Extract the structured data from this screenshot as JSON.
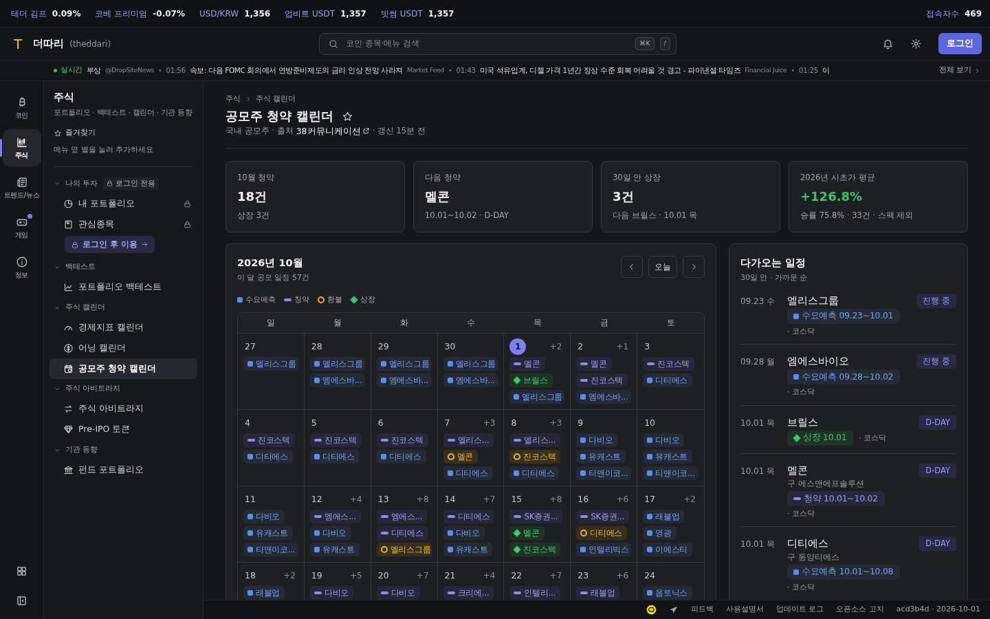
{
  "ticker_bar": {
    "items": [
      {
        "label": "테더 김프",
        "value": "0.09%"
      },
      {
        "label": "코베 프리미엄",
        "value": "-0.07%"
      },
      {
        "label": "USD/KRW",
        "value": "1,356"
      },
      {
        "label": "업비트 USDT",
        "value": "1,357"
      },
      {
        "label": "빗썸 USDT",
        "value": "1,357"
      }
    ],
    "visitors": {
      "label": "접속자수",
      "value": "469"
    }
  },
  "header": {
    "logo_mark": "T",
    "brand": "더따리",
    "brand_sub": "(theddari)",
    "search": {
      "placeholder": "코인·종목·메뉴 검색",
      "shortcuts": [
        "⌘K",
        "/"
      ]
    },
    "login_button": "로그인"
  },
  "news": {
    "live_label": "실시간",
    "see_all": "전체 보기",
    "separator": "•",
    "items": [
      {
        "title": "부상",
        "source": "@DropSiteNews"
      },
      {
        "time": "01:56",
        "title": "속보: 다음 FOMC 회의에서 연방준비제도의 금리 인상 전망 사라져",
        "source": "Market Feed"
      },
      {
        "time": "01:43",
        "title": "미국 석유업계, 디젤 가격 1년간 정상 수준 회복 어려울 것 경고 - 파이낸셜 타임즈",
        "source": "Financial Juice"
      },
      {
        "time": "01:25",
        "title": "이"
      }
    ]
  },
  "rail": {
    "items": [
      {
        "kind": "coin",
        "label": "코인",
        "selected": false,
        "notification": false
      },
      {
        "kind": "stock",
        "label": "주식",
        "selected": true,
        "notification": false
      },
      {
        "kind": "news",
        "label": "트렌드/뉴스",
        "selected": false,
        "notification": false
      },
      {
        "kind": "game",
        "label": "게임",
        "selected": false,
        "notification": true
      },
      {
        "kind": "info",
        "label": "정보",
        "selected": false,
        "notification": false
      }
    ]
  },
  "sidebar": {
    "title": "주식",
    "subtitle": "포트폴리오 · 백테스트 · 캘린더 · 기관 동향",
    "favorites": {
      "label": "즐겨찾기",
      "hint": "메뉴 옆 별을 눌러 추가하세요"
    },
    "groups": [
      {
        "label": "나의 투자",
        "expanded": true,
        "badge": "로그인 전용",
        "items": [
          {
            "kind": "portfolio",
            "label": "내 포트폴리오",
            "locked": true,
            "selected": false
          },
          {
            "kind": "watchlist",
            "label": "관심종목",
            "locked": true,
            "selected": false
          }
        ],
        "action": "로그인 후 이용"
      },
      {
        "label": "백테스트",
        "expanded": true,
        "items": [
          {
            "kind": "backtest",
            "label": "포트폴리오 백테스트",
            "locked": false,
            "selected": false
          }
        ]
      },
      {
        "label": "주식 캘린더",
        "expanded": true,
        "items": [
          {
            "kind": "economic",
            "label": "경제지표 캘린더",
            "locked": false,
            "selected": false
          },
          {
            "kind": "earnings",
            "label": "어닝 캘린더",
            "locked": false,
            "selected": false
          },
          {
            "kind": "ipo",
            "label": "공모주 청약 캘린더",
            "locked": false,
            "selected": true
          }
        ]
      },
      {
        "label": "주식 아비트라지",
        "expanded": true,
        "items": [
          {
            "kind": "arbitrage",
            "label": "주식 아비트라지",
            "locked": false,
            "selected": false
          },
          {
            "kind": "token",
            "label": "Pre-IPO 토큰",
            "locked": false,
            "selected": false
          }
        ]
      },
      {
        "label": "기관 동향",
        "expanded": true,
        "items": [
          {
            "kind": "fund",
            "label": "펀드 포트폴리오",
            "locked": false,
            "selected": false
          }
        ]
      }
    ]
  },
  "page": {
    "breadcrumb": [
      "주식",
      "주식 캘린더"
    ],
    "title": "공모주 청약 캘린더",
    "favorite": false,
    "subline": {
      "prefix": "국내 공모주 · 출처",
      "link": "38커뮤니케이션",
      "suffix": "· 갱신 15분 전"
    },
    "stats": [
      {
        "label": "10월 청약",
        "value": "18건",
        "note": "상장 3건",
        "positive": false
      },
      {
        "label": "다음 청약",
        "value": "멜콘",
        "note": "10.01~10.02 · D-DAY",
        "positive": false
      },
      {
        "label": "30일 안 상장",
        "value": "3건",
        "note": "다음 브릴스 · 10.01 목",
        "positive": false
      },
      {
        "label": "2026년 시초가 평균",
        "value": "+126.8%",
        "note": "승률 75.8% · 33건 · 스팩 제외",
        "positive": true
      }
    ]
  },
  "calendar": {
    "title": "2026년 10월",
    "subtitle": "이 달 공모 일정 57건",
    "today_button": "오늘",
    "legend": [
      {
        "kind": "demand",
        "label": "수요예측"
      },
      {
        "kind": "subscription",
        "label": "청약"
      },
      {
        "kind": "refund",
        "label": "환불"
      },
      {
        "kind": "listing",
        "label": "상장"
      }
    ],
    "weekdays": [
      "일",
      "월",
      "화",
      "수",
      "목",
      "금",
      "토"
    ],
    "weeks": [
      [
        {
          "day": "27",
          "today": false,
          "events": [
            {
              "kind": "demand",
              "label": "엘리스그룹"
            }
          ]
        },
        {
          "day": "28",
          "today": false,
          "events": [
            {
              "kind": "demand",
              "label": "엘리스그룹"
            },
            {
              "kind": "demand",
              "label": "엠에스바..."
            }
          ]
        },
        {
          "day": "29",
          "today": false,
          "events": [
            {
              "kind": "demand",
              "label": "엘리스그룹"
            },
            {
              "kind": "demand",
              "label": "엠에스바..."
            }
          ]
        },
        {
          "day": "30",
          "today": false,
          "events": [
            {
              "kind": "demand",
              "label": "엘리스그룹"
            },
            {
              "kind": "demand",
              "label": "엠에스바..."
            }
          ]
        },
        {
          "day": "1",
          "more": "+2",
          "today": true,
          "events": [
            {
              "kind": "subscription",
              "label": "멜콘"
            },
            {
              "kind": "listing",
              "label": "브릴스"
            },
            {
              "kind": "demand",
              "label": "엘리스그룹"
            }
          ]
        },
        {
          "day": "2",
          "more": "+1",
          "today": false,
          "events": [
            {
              "kind": "subscription",
              "label": "멜콘"
            },
            {
              "kind": "subscription",
              "label": "진코스텍"
            },
            {
              "kind": "demand",
              "label": "엠에스바..."
            }
          ]
        },
        {
          "day": "3",
          "today": false,
          "events": [
            {
              "kind": "subscription",
              "label": "진코스텍"
            },
            {
              "kind": "demand",
              "label": "디티에스"
            }
          ]
        }
      ],
      [
        {
          "day": "4",
          "today": false,
          "events": [
            {
              "kind": "subscription",
              "label": "진코스텍"
            },
            {
              "kind": "demand",
              "label": "디티에스"
            }
          ]
        },
        {
          "day": "5",
          "today": false,
          "events": [
            {
              "kind": "subscription",
              "label": "진코스텍"
            },
            {
              "kind": "demand",
              "label": "디티에스"
            }
          ]
        },
        {
          "day": "6",
          "today": false,
          "events": [
            {
              "kind": "subscription",
              "label": "진코스텍"
            },
            {
              "kind": "demand",
              "label": "디티에스"
            }
          ]
        },
        {
          "day": "7",
          "more": "+3",
          "today": false,
          "events": [
            {
              "kind": "subscription",
              "label": "엘리스..."
            },
            {
              "kind": "refund",
              "label": "멜콘"
            },
            {
              "kind": "demand",
              "label": "디티에스"
            }
          ]
        },
        {
          "day": "8",
          "more": "+3",
          "today": false,
          "events": [
            {
              "kind": "subscription",
              "label": "엘리스..."
            },
            {
              "kind": "refund",
              "label": "진코스텍"
            },
            {
              "kind": "demand",
              "label": "디티에스"
            }
          ]
        },
        {
          "day": "9",
          "today": false,
          "events": [
            {
              "kind": "demand",
              "label": "다비오"
            },
            {
              "kind": "demand",
              "label": "유캐스트"
            },
            {
              "kind": "demand",
              "label": "티앤이코..."
            }
          ]
        },
        {
          "day": "10",
          "today": false,
          "events": [
            {
              "kind": "demand",
              "label": "다비오"
            },
            {
              "kind": "demand",
              "label": "유캐스트"
            },
            {
              "kind": "demand",
              "label": "티앤이코..."
            }
          ]
        }
      ],
      [
        {
          "day": "11",
          "today": false,
          "events": [
            {
              "kind": "demand",
              "label": "다비오"
            },
            {
              "kind": "demand",
              "label": "유캐스트"
            },
            {
              "kind": "demand",
              "label": "티앤이코..."
            }
          ]
        },
        {
          "day": "12",
          "more": "+4",
          "today": false,
          "events": [
            {
              "kind": "subscription",
              "label": "엠에스..."
            },
            {
              "kind": "demand",
              "label": "다비오"
            },
            {
              "kind": "demand",
              "label": "유캐스트"
            }
          ]
        },
        {
          "day": "13",
          "more": "+8",
          "today": false,
          "events": [
            {
              "kind": "subscription",
              "label": "엠에스..."
            },
            {
              "kind": "subscription",
              "label": "디티에스"
            },
            {
              "kind": "refund",
              "label": "엘리스그룹"
            }
          ]
        },
        {
          "day": "14",
          "more": "+7",
          "today": false,
          "events": [
            {
              "kind": "subscription",
              "label": "디티에스"
            },
            {
              "kind": "demand",
              "label": "다비오"
            },
            {
              "kind": "demand",
              "label": "유캐스트"
            }
          ]
        },
        {
          "day": "15",
          "more": "+8",
          "today": false,
          "events": [
            {
              "kind": "subscription",
              "label": "SK증권..."
            },
            {
              "kind": "listing",
              "label": "멜콘"
            },
            {
              "kind": "listing",
              "label": "진코스텍"
            }
          ]
        },
        {
          "day": "16",
          "more": "+6",
          "today": false,
          "events": [
            {
              "kind": "subscription",
              "label": "SK증권..."
            },
            {
              "kind": "refund",
              "label": "디티에스"
            },
            {
              "kind": "demand",
              "label": "인텔리빅스"
            }
          ]
        },
        {
          "day": "17",
          "more": "+2",
          "today": false,
          "events": [
            {
              "kind": "demand",
              "label": "래블업"
            },
            {
              "kind": "demand",
              "label": "영광"
            },
            {
              "kind": "demand",
              "label": "이에스티"
            }
          ]
        }
      ],
      [
        {
          "day": "18",
          "more": "+2",
          "today": false,
          "events": [
            {
              "kind": "demand",
              "label": "래블업"
            }
          ]
        },
        {
          "day": "19",
          "more": "+5",
          "today": false,
          "events": [
            {
              "kind": "subscription",
              "label": "다비오"
            }
          ]
        },
        {
          "day": "20",
          "more": "+7",
          "today": false,
          "events": [
            {
              "kind": "subscription",
              "label": "다비오"
            }
          ]
        },
        {
          "day": "21",
          "more": "+4",
          "today": false,
          "events": [
            {
              "kind": "subscription",
              "label": "크리에..."
            }
          ]
        },
        {
          "day": "22",
          "more": "+7",
          "today": false,
          "events": [
            {
              "kind": "subscription",
              "label": "인텔리..."
            }
          ]
        },
        {
          "day": "23",
          "more": "+6",
          "today": false,
          "events": [
            {
              "kind": "subscription",
              "label": "래블업"
            }
          ]
        },
        {
          "day": "24",
          "today": false,
          "events": [
            {
              "kind": "demand",
              "label": "옵토닉스"
            }
          ]
        }
      ]
    ]
  },
  "upcoming": {
    "title": "다가오는 일정",
    "subtitle": "30일 안 · 가까운 순",
    "items": [
      {
        "date": "09.23 수",
        "name": "엘리스그룹",
        "status": "진행 중",
        "event": {
          "kind": "demand",
          "label": "수요예측 09.23~10.01"
        },
        "market": "· 코스닥"
      },
      {
        "date": "09.28 월",
        "name": "엠에스바이오",
        "status": "진행 중",
        "event": {
          "kind": "demand",
          "label": "수요예측 09.28~10.02"
        },
        "market": "· 코스닥"
      },
      {
        "date": "10.01 목",
        "name": "브릴스",
        "status": "D-DAY",
        "event": {
          "kind": "listing",
          "label": "상장 10.01"
        },
        "market": "· 코스닥"
      },
      {
        "date": "10.01 목",
        "name": "멜콘",
        "status": "D-DAY",
        "former": "구 에스앤에프솔루션",
        "event": {
          "kind": "subscription",
          "label": "청약 10.01~10.02"
        },
        "market": "· 코스닥"
      },
      {
        "date": "10.01 목",
        "name": "디티에스",
        "status": "D-DAY",
        "former": "구 동양티에스",
        "event": {
          "kind": "demand",
          "label": "수요예측 10.01~10.08"
        },
        "market": "· 코스닥"
      }
    ]
  },
  "footer": {
    "links": [
      "피드백",
      "사용설명서",
      "업데이트 로그",
      "오픈소스 고지"
    ],
    "version": "acd3b4d · 2026-10-01"
  }
}
